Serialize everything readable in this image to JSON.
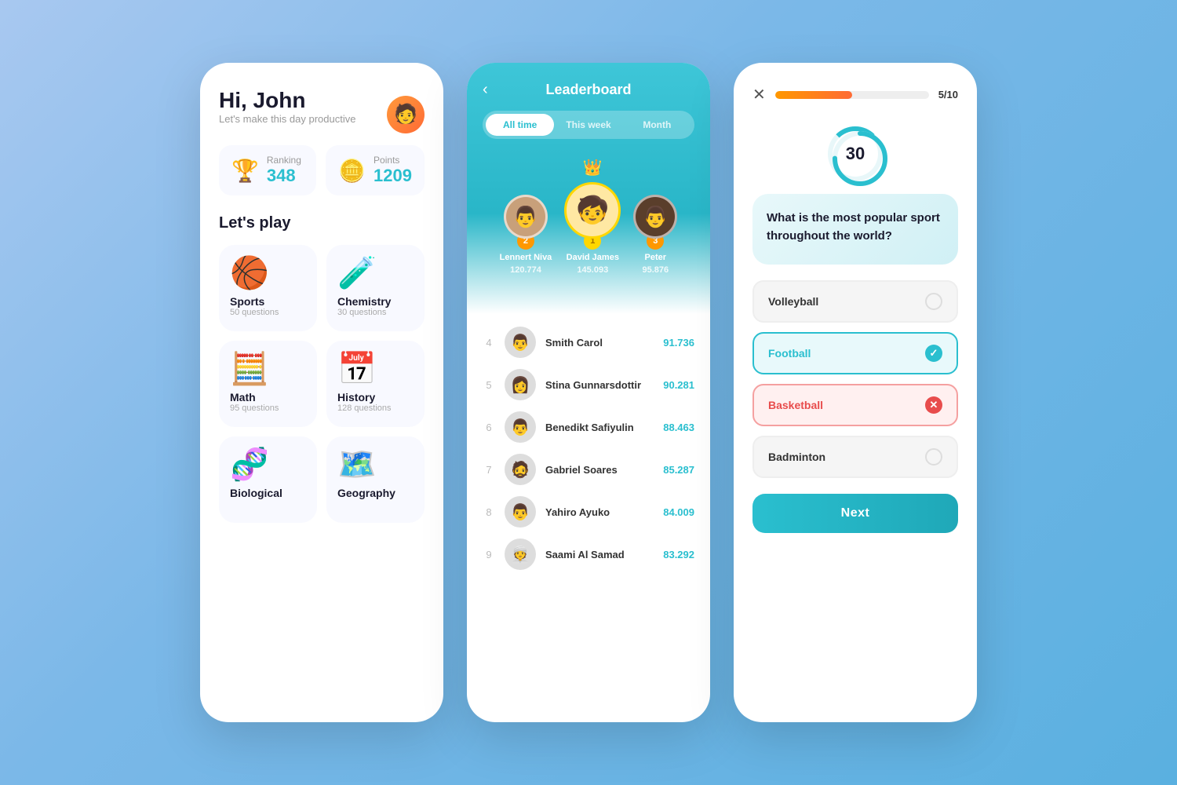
{
  "card1": {
    "greeting": "Hi, John",
    "subtitle": "Let's make this day productive",
    "avatar_emoji": "🧑",
    "stats": {
      "ranking_label": "Ranking",
      "ranking_value": "348",
      "points_label": "Points",
      "points_value": "1209",
      "ranking_icon": "🏆",
      "points_icon": "🪙"
    },
    "section_title": "Let's play",
    "subjects": [
      {
        "name": "Sports",
        "count": "50 questions",
        "icon": "🏀"
      },
      {
        "name": "Chemistry",
        "count": "30 questions",
        "icon": "🧪"
      },
      {
        "name": "Math",
        "count": "95 questions",
        "icon": "🧮"
      },
      {
        "name": "History",
        "count": "128 questions",
        "icon": "📅"
      },
      {
        "name": "Biological",
        "count": "",
        "icon": "🧬"
      },
      {
        "name": "Geography",
        "count": "",
        "icon": "🗺️"
      }
    ]
  },
  "card2": {
    "title": "Leaderboard",
    "back_icon": "‹",
    "tabs": [
      {
        "label": "All time",
        "active": true
      },
      {
        "label": "This week",
        "active": false
      },
      {
        "label": "Month",
        "active": false
      }
    ],
    "podium": [
      {
        "rank": 2,
        "name": "Lennert Niva",
        "score": "120.774",
        "pos": "second",
        "emoji": "👨"
      },
      {
        "rank": 1,
        "name": "David James",
        "score": "145.093",
        "pos": "first",
        "emoji": "🧒"
      },
      {
        "rank": 3,
        "name": "Peter",
        "score": "95.876",
        "pos": "third",
        "emoji": "👨"
      }
    ],
    "list": [
      {
        "rank": 4,
        "name": "Smith Carol",
        "score": "91.736",
        "emoji": "👨"
      },
      {
        "rank": 5,
        "name": "Stina Gunnarsdottir",
        "score": "90.281",
        "emoji": "👩"
      },
      {
        "rank": 6,
        "name": "Benedikt Safiyulin",
        "score": "88.463",
        "emoji": "👨"
      },
      {
        "rank": 7,
        "name": "Gabriel Soares",
        "score": "85.287",
        "emoji": "👨"
      },
      {
        "rank": 8,
        "name": "Yahiro Ayuko",
        "score": "84.009",
        "emoji": "👨"
      },
      {
        "rank": 9,
        "name": "Saami Al Samad",
        "score": "83.292",
        "emoji": "👨"
      }
    ]
  },
  "card3": {
    "close_icon": "✕",
    "progress_current": 5,
    "progress_total": 10,
    "progress_percent": 50,
    "progress_label": "5/10",
    "timer_value": "30",
    "question": "What is the most popular sport throughout the world?",
    "options": [
      {
        "label": "Volleyball",
        "state": "neutral"
      },
      {
        "label": "Football",
        "state": "correct"
      },
      {
        "label": "Basketball",
        "state": "wrong"
      },
      {
        "label": "Badminton",
        "state": "neutral"
      }
    ],
    "next_label": "Next"
  }
}
